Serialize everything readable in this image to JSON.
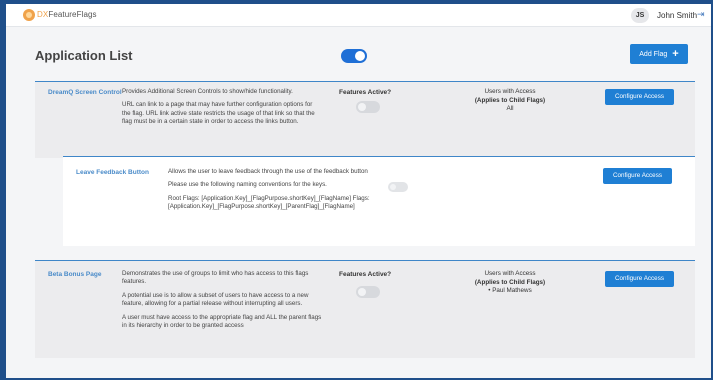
{
  "header": {
    "brand_prefix": "DX",
    "brand_name": "FeatureFlags",
    "user_initials": "JS",
    "user_name": "John Smith",
    "logout_glyph": "⇥"
  },
  "page": {
    "title": "Application List",
    "master_toggle_on": true,
    "add_flag_label": "Add Flag",
    "add_flag_icon": "+"
  },
  "flags": [
    {
      "name": "DreamQ Screen Control",
      "description": [
        "Provides Additional Screen Controls to show/hide functionality.",
        "URL can link to a page that may have further configuration options for the flag. URL link active state restricts the usage of that link so that the flag must be in a certain state in order to access the links button."
      ],
      "features_active_label": "Features Active?",
      "active": false,
      "access_title": "Users with Access",
      "access_subtitle": "(Applies to Child Flags)",
      "access_users": [
        "All"
      ],
      "configure_label": "Configure Access"
    },
    {
      "name": "Leave Feedback Button",
      "description": [
        "Allows the user to leave feedback through the use of the feedback button",
        "Please use the following naming conventions for the keys.",
        "Root Flags: [Application.Key]_[FlagPurpose.shortKey]_[FlagName] Flags: [Application.Key]_[FlagPurpose.shortKey]_[ParentFlag]_[FlagName]"
      ],
      "active": false,
      "configure_label": "Configure Access"
    },
    {
      "name": "Beta Bonus Page",
      "description": [
        "Demonstrates the use of groups to limit who has access to this flags features.",
        "A potential use is to allow a subset of users to have access to a new feature, allowing for a partial release without interrupting all users.",
        "A user must have access to the appropriate flag and ALL the parent flags in its hierarchy in order to be granted access"
      ],
      "features_active_label": "Features Active?",
      "active": false,
      "access_title": "Users with Access",
      "access_subtitle": "(Applies to Child Flags)",
      "access_users": [
        "• Paul Mathews"
      ],
      "configure_label": "Configure Access"
    }
  ]
}
